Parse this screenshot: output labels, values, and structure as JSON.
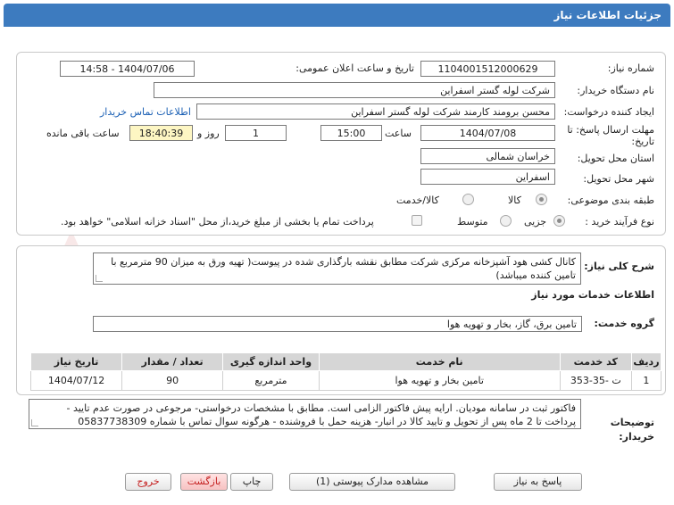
{
  "header": {
    "title": "جزئیات اطلاعات نیاز"
  },
  "form": {
    "need_number_label": "شماره نیاز:",
    "need_number": "1104001512000629",
    "announce_label": "تاریخ و ساعت اعلان عمومی:",
    "announce_value": "1404/07/06 - 14:58",
    "buyer_org_label": "نام دستگاه خریدار:",
    "buyer_org": "شرکت لوله گستر اسفراین",
    "creator_label": "ایجاد کننده درخواست:",
    "creator": "محسن برومند کارمند شرکت لوله گستر اسفراین",
    "contact_link": "اطلاعات تماس خریدار",
    "deadline_label": "مهلت ارسال پاسخ: تا تاریخ:",
    "deadline_date": "1404/07/08",
    "time_label": "ساعت",
    "deadline_time": "15:00",
    "days_value": "1",
    "days_label": "روز و",
    "remaining_time": "18:40:39",
    "remaining_label": "ساعت باقی مانده",
    "province_label": "استان محل تحویل:",
    "province": "خراسان شمالی",
    "city_label": "شهر محل تحویل:",
    "city": "اسفراین",
    "category_label": "طبقه بندی موضوعی:",
    "category_options": [
      "کالا",
      "کالا/خدمت"
    ],
    "process_label": "نوع فرآیند خرید :",
    "process_options": [
      "جزیی",
      "متوسط"
    ],
    "payment_note": "پرداخت تمام یا بخشی از مبلغ خرید،از محل \"اسناد خزانه اسلامی\" خواهد بود."
  },
  "summary": {
    "label": "شرح کلی نیاز:",
    "text": "کانال کشی هود آشپزخانه مرکزی شرکت مطابق نقشه بارگذاری شده در پیوست( تهیه ورق به میزان 90 مترمربع با تامین کننده میباشد)"
  },
  "services": {
    "section_title": "اطلاعات خدمات مورد نیاز",
    "group_label": "گروه خدمت:",
    "group_value": "تامین برق، گاز، بخار و تهویه هوا",
    "columns": [
      "ردیف",
      "کد خدمت",
      "نام خدمت",
      "واحد اندازه گیری",
      "تعداد / مقدار",
      "تاریخ نیاز"
    ],
    "rows": [
      [
        "1",
        "ت -35-353",
        "تامین بخار و تهویه هوا",
        "مترمربع",
        "90",
        "1404/07/12"
      ]
    ]
  },
  "buyer_notes": {
    "label": "توضیحات خریدار:",
    "text": "فاکتور ثبت در سامانه مودیان. ارایه پیش فاکتور الزامی است. مطابق با مشخصات درخواستی- مرجوعی در صورت عدم تایید - پرداخت تا 2 ماه پس از تحویل و تایید کالا در انبار- هزینه حمل با فروشنده - هرگونه سوال تماس با شماره 05837738309"
  },
  "buttons": {
    "reply": "پاسخ به نیاز",
    "attachments": "مشاهده مدارک پیوستی (1)",
    "print": "چاپ",
    "back": "بازگشت",
    "exit": "خروج"
  }
}
